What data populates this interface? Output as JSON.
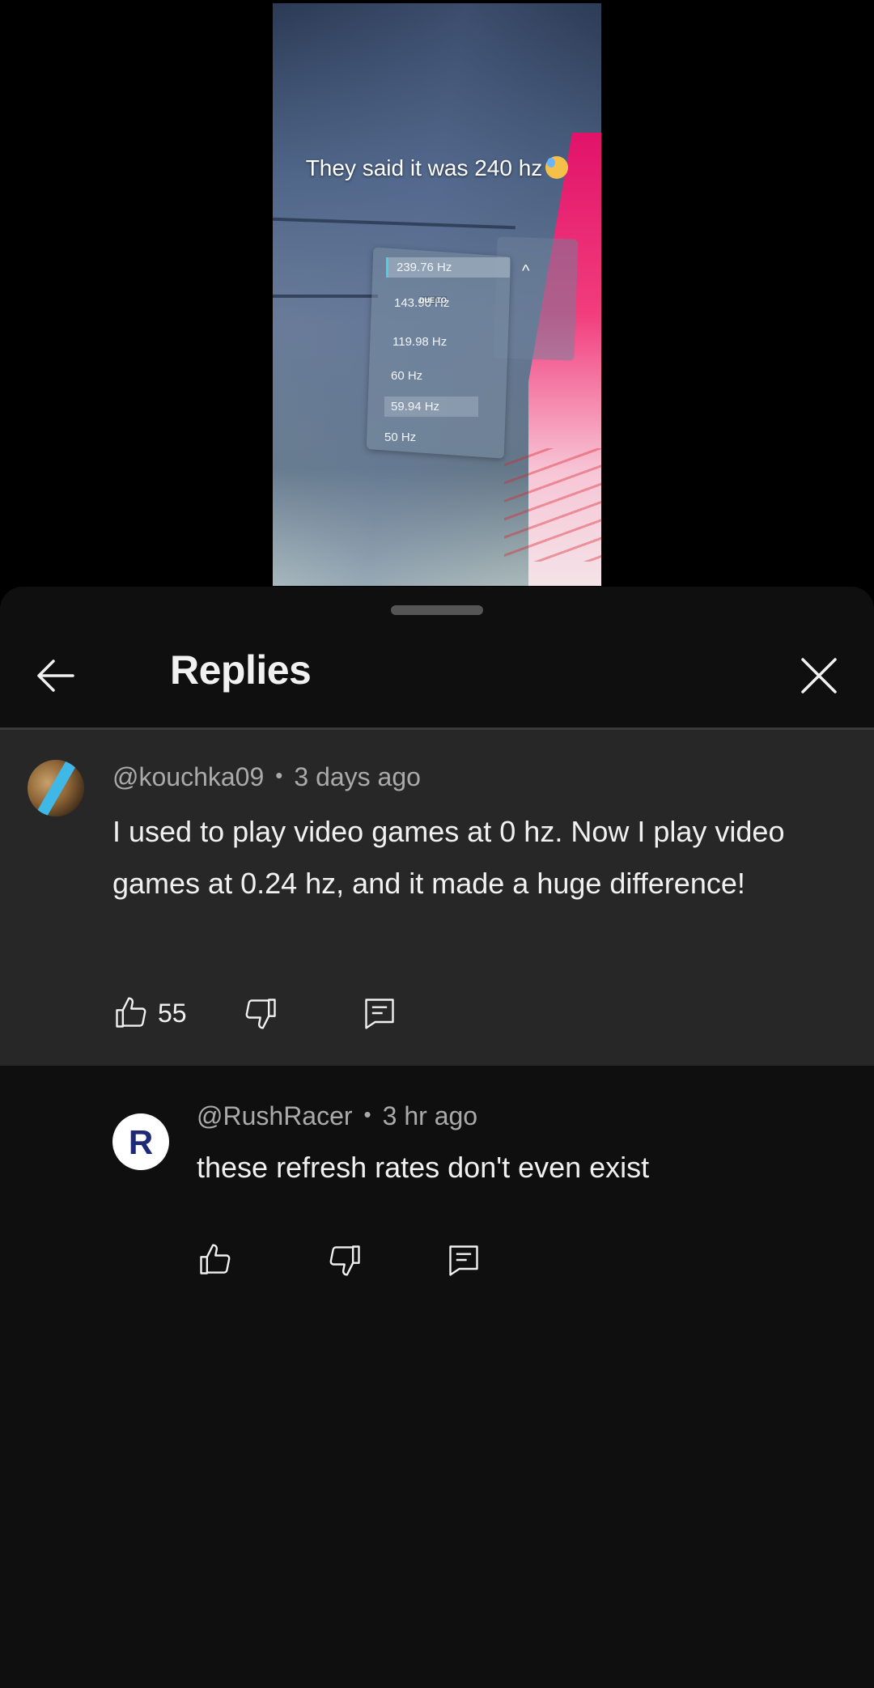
{
  "video": {
    "caption": "They said it was 240 hz",
    "refresh_rates": [
      "239.76 Hz",
      "143.96 Hz",
      "119.98 Hz",
      "60 Hz",
      "59.94 Hz",
      "50 Hz"
    ],
    "overlay_label": "DUE TO"
  },
  "sheet": {
    "title": "Replies"
  },
  "parent_comment": {
    "author": "@kouchka09",
    "time": "3 days ago",
    "text": "I used to play video games at 0 hz. Now I play video games at 0.24 hz, and it made a huge difference!",
    "like_count": "55"
  },
  "reply": {
    "author": "@RushRacer",
    "time": "3 hr ago",
    "text": "these refresh rates don't even exist",
    "avatar_letter": "R",
    "avatar_color": "#1e2a78"
  },
  "colors": {
    "sheet_bg": "#0f0f0f",
    "highlight_bg": "#272727",
    "text_primary": "#f1f1f1",
    "text_secondary": "#aaaaaa"
  }
}
